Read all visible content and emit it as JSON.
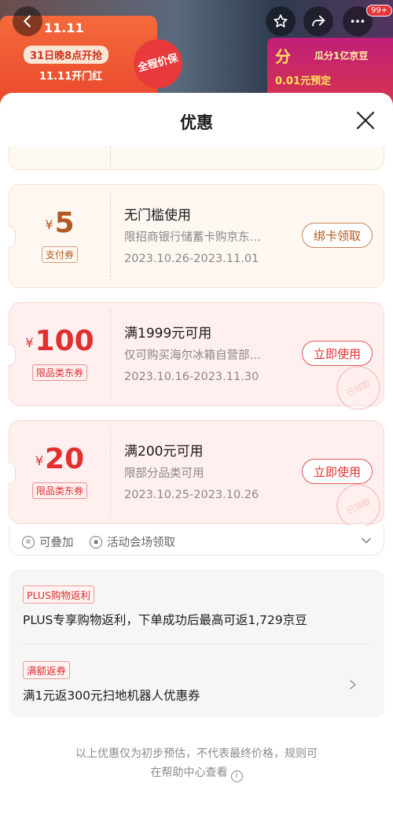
{
  "banner": {
    "logo": "11.11",
    "promo": "31日晚8点开抢",
    "promo_sub": "11.11开门红",
    "badge_circle": "全程价保",
    "right_fen": "分",
    "right_guafen": "瓜分1亿京豆",
    "right_presale": "0.01元预定",
    "more_badge": "99+"
  },
  "sheet": {
    "title": "优惠"
  },
  "coupons": [
    {
      "type": "pay",
      "yen": "¥",
      "amount": "5",
      "tag": "支付券",
      "title": "无门槛使用",
      "desc": "限招商银行储蓄卡购京东…",
      "date": "2023.10.26-2023.11.01",
      "button": "绑卡领取",
      "stamp": ""
    },
    {
      "type": "limit",
      "yen": "¥",
      "amount": "100",
      "tag": "限品类东券",
      "title": "满1999元可用",
      "desc": "仅可购买海尔冰箱自营部…",
      "date": "2023.10.16-2023.11.30",
      "button": "立即使用",
      "stamp": "已领取"
    },
    {
      "type": "limit",
      "yen": "¥",
      "amount": "20",
      "tag": "限品类东券",
      "title": "满200元可用",
      "desc": "限部分品类可用",
      "date": "2023.10.25-2023.10.26",
      "button": "立即使用",
      "stamp": "已领取"
    }
  ],
  "footer_bar": {
    "stackable": "可叠加",
    "venue": "活动会场领取"
  },
  "rebate": {
    "tag1": "PLUS购物返利",
    "text1": "PLUS专享购物返利，下单成功后最高可返1,729京豆",
    "tag2": "满额返券",
    "text2": "满1元返300元扫地机器人优惠券"
  },
  "disclaimer": {
    "line1": "以上优惠仅为初步预估，不代表最终价格，规则可",
    "line2": "在帮助中心查看"
  },
  "colors": {
    "accent_red": "#e0302f",
    "pay_brown": "#b35a22"
  }
}
